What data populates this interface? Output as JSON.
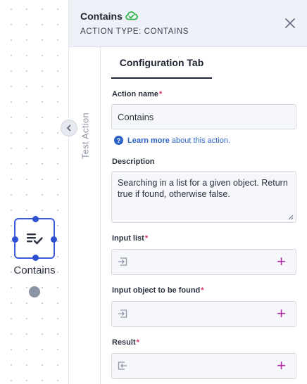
{
  "canvas": {
    "node_label": "Contains"
  },
  "panel": {
    "title": "Contains",
    "subtitle": "ACTION TYPE: CONTAINS",
    "side_tab_label": "Test Action",
    "tab_label": "Configuration Tab",
    "action_name": {
      "label": "Action name",
      "required": "*",
      "value": "Contains"
    },
    "help": {
      "link": "Learn more",
      "text": "about this action."
    },
    "description": {
      "label": "Description",
      "value": "Searching in a list for a given object. Return true if found, otherwise false."
    },
    "inputs": [
      {
        "label": "Input list",
        "required": "*",
        "add": "+"
      },
      {
        "label": "Input object to be found",
        "required": "*",
        "add": "+"
      },
      {
        "label": "Result",
        "required": "*",
        "add": "+"
      }
    ]
  },
  "icons": {
    "cloud": "cloud-check-icon",
    "close": "close-icon",
    "collapse": "chevron-left-icon",
    "node": "list-check-icon",
    "help": "question-icon",
    "input": "input-arrow-icon",
    "output": "output-arrow-icon"
  },
  "colors": {
    "accent_blue": "#3b5bdb",
    "cloud_green": "#2fb344",
    "required_pink": "#d6336c",
    "plus_magenta": "#b02aa4",
    "link_blue": "#2b63c6"
  }
}
